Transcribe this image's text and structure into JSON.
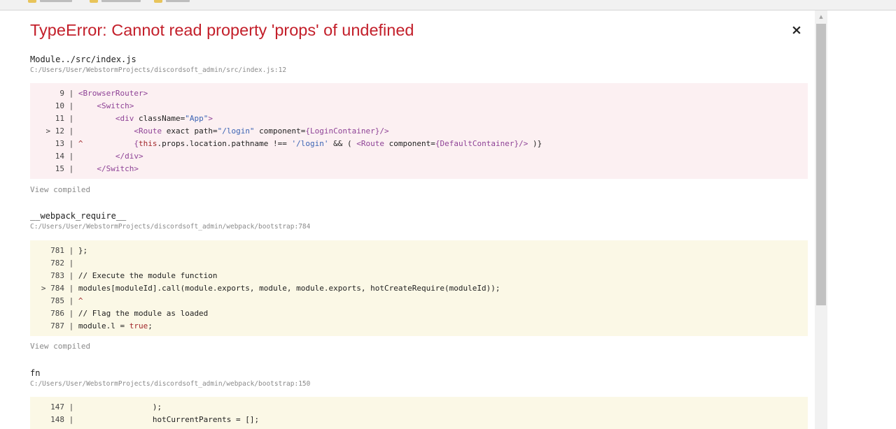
{
  "overlay": {
    "title": "TypeError: Cannot read property 'props' of undefined",
    "close_icon": "×",
    "view_compiled_label": "View compiled",
    "frames": [
      {
        "name": "Module../src/index.js",
        "path": "C:/Users/User/WebstormProjects/discordsoft_admin/src/index.js:12",
        "lines": [
          {
            "marker": "  ",
            "num": "9",
            "parts": [
              {
                "t": "tag",
                "v": "<BrowserRouter>"
              }
            ]
          },
          {
            "marker": "  ",
            "num": "10",
            "parts": [
              {
                "t": "plain",
                "v": "    "
              },
              {
                "t": "tag",
                "v": "<Switch>"
              }
            ]
          },
          {
            "marker": "  ",
            "num": "11",
            "parts": [
              {
                "t": "plain",
                "v": "        "
              },
              {
                "t": "tag",
                "v": "<div "
              },
              {
                "t": "plain",
                "v": "className="
              },
              {
                "t": "str",
                "v": "\"App\""
              },
              {
                "t": "tag",
                "v": ">"
              }
            ]
          },
          {
            "marker": "> ",
            "num": "12",
            "parts": [
              {
                "t": "plain",
                "v": "            "
              },
              {
                "t": "tag",
                "v": "<Route "
              },
              {
                "t": "plain",
                "v": "exact path="
              },
              {
                "t": "str",
                "v": "\"/login\""
              },
              {
                "t": "plain",
                "v": " component="
              },
              {
                "t": "tag",
                "v": "{LoginContainer}/>"
              }
            ]
          },
          {
            "marker": "  ",
            "num": "13",
            "caret": true,
            "parts": [
              {
                "t": "plain",
                "v": "           "
              },
              {
                "t": "tag",
                "v": "{"
              },
              {
                "t": "kw",
                "v": "this"
              },
              {
                "t": "plain",
                "v": ".props.location.pathname !== "
              },
              {
                "t": "str",
                "v": "'/login'"
              },
              {
                "t": "plain",
                "v": " && ( "
              },
              {
                "t": "tag",
                "v": "<Route "
              },
              {
                "t": "plain",
                "v": "component="
              },
              {
                "t": "tag",
                "v": "{DefaultContainer}/>"
              },
              {
                "t": "plain",
                "v": " )}"
              }
            ]
          },
          {
            "marker": "  ",
            "num": "14",
            "parts": [
              {
                "t": "plain",
                "v": "        "
              },
              {
                "t": "tag",
                "v": "</div>"
              }
            ]
          },
          {
            "marker": "  ",
            "num": "15",
            "parts": [
              {
                "t": "plain",
                "v": "    "
              },
              {
                "t": "tag",
                "v": "</Switch>"
              }
            ]
          }
        ]
      },
      {
        "name": "__webpack_require__",
        "path": "C:/Users/User/WebstormProjects/discordsoft_admin/webpack/bootstrap:784",
        "lines": [
          {
            "marker": "  ",
            "num": "781",
            "parts": [
              {
                "t": "plain",
                "v": "};"
              }
            ]
          },
          {
            "marker": "  ",
            "num": "782",
            "parts": []
          },
          {
            "marker": "  ",
            "num": "783",
            "parts": [
              {
                "t": "plain",
                "v": "// Execute the module function"
              }
            ]
          },
          {
            "marker": "> ",
            "num": "784",
            "parts": [
              {
                "t": "plain",
                "v": "modules[moduleId].call(module.exports, module, module.exports, hotCreateRequire(moduleId));"
              }
            ]
          },
          {
            "marker": "  ",
            "num": "785",
            "caret": true,
            "parts": []
          },
          {
            "marker": "  ",
            "num": "786",
            "parts": [
              {
                "t": "plain",
                "v": "// Flag the module as loaded"
              }
            ]
          },
          {
            "marker": "  ",
            "num": "787",
            "parts": [
              {
                "t": "plain",
                "v": "module.l = "
              },
              {
                "t": "kw",
                "v": "true"
              },
              {
                "t": "plain",
                "v": ";"
              }
            ]
          }
        ]
      },
      {
        "name": "fn",
        "path": "C:/Users/User/WebstormProjects/discordsoft_admin/webpack/bootstrap:150",
        "lines": [
          {
            "marker": "  ",
            "num": "147",
            "parts": [
              {
                "t": "plain",
                "v": "                );"
              }
            ]
          },
          {
            "marker": "  ",
            "num": "148",
            "parts": [
              {
                "t": "plain",
                "v": "                hotCurrentParents = [];"
              }
            ]
          }
        ]
      }
    ]
  },
  "colors": {
    "error_title": "#c31f2a",
    "error_code_bg": "#fcf0f2",
    "context_code_bg": "#fbf8e6",
    "jsx_tag": "#8e4296",
    "string": "#3c64b4",
    "keyword": "#a1262a"
  }
}
